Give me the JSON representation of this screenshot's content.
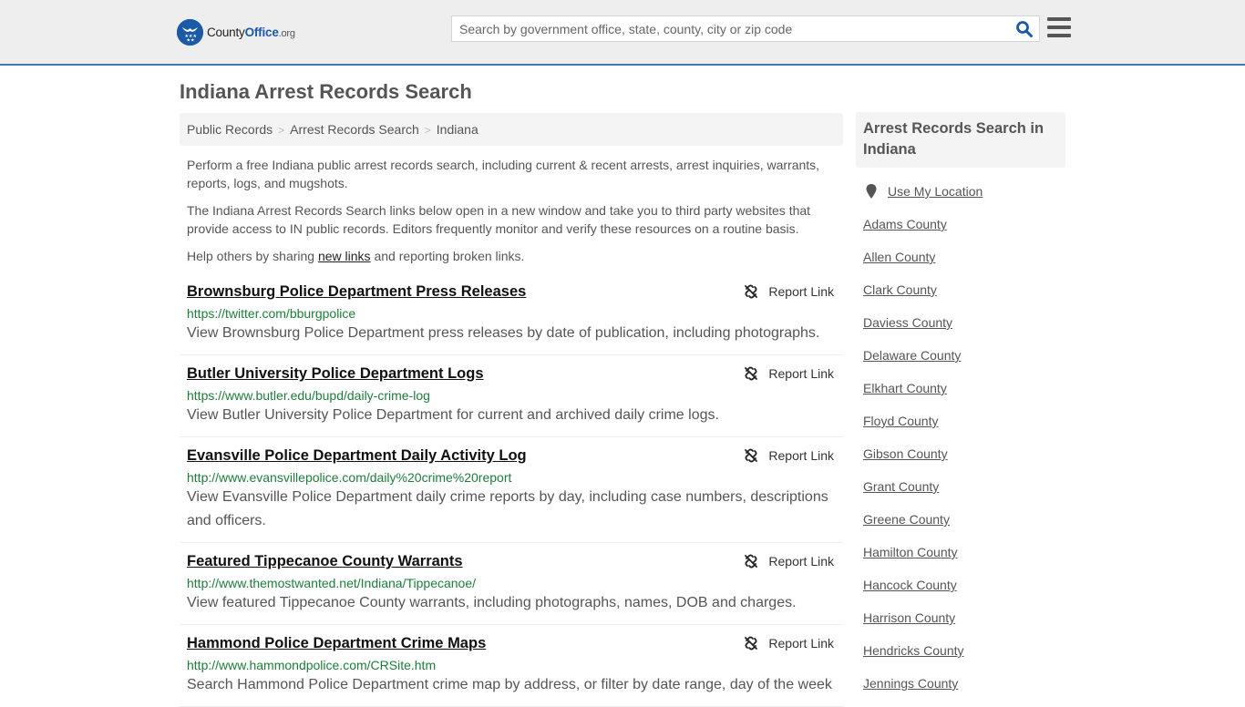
{
  "header": {
    "logo": {
      "name": "County",
      "highlight": "Office",
      "suffix": ".org"
    },
    "search": {
      "placeholder": "Search by government office, state, county, city or zip code",
      "value": ""
    },
    "colors": {
      "brand": "#1a5aa6",
      "header_bg": "#eeeeee",
      "accent_border": "#3b79b7"
    }
  },
  "page": {
    "title": "Indiana Arrest Records Search",
    "breadcrumb": [
      "Public Records",
      "Arrest Records Search",
      "Indiana"
    ],
    "intro": {
      "p1": "Perform a free Indiana public arrest records search, including current & recent arrests, arrest inquiries, warrants, reports, logs, and mugshots.",
      "p2": "The Indiana Arrest Records Search links below open in a new window and take you to third party websites that provide access to IN public records. Editors frequently monitor and verify these resources on a routine basis.",
      "p3_before": "Help others by sharing ",
      "p3_link": "new links",
      "p3_after": " and reporting broken links."
    },
    "report_label": "Report Link",
    "results": [
      {
        "title": "Brownsburg Police Department Press Releases",
        "url": "https://twitter.com/bburgpolice",
        "description": "View Brownsburg Police Department press releases by date of publication, including photographs."
      },
      {
        "title": "Butler University Police Department Logs",
        "url": "https://www.butler.edu/bupd/daily-crime-log",
        "description": "View Butler University Police Department for current and archived daily crime logs."
      },
      {
        "title": "Evansville Police Department Daily Activity Log",
        "url": "http://www.evansvillepolice.com/daily%20crime%20report",
        "description": "View Evansville Police Department daily crime reports by day, including case numbers, descriptions and officers."
      },
      {
        "title": "Featured Tippecanoe County Warrants",
        "url": "http://www.themostwanted.net/Indiana/Tippecanoe/",
        "description": "View featured Tippecanoe County warrants, including photographs, names, DOB and charges."
      },
      {
        "title": "Hammond Police Department Crime Maps",
        "url": "http://www.hammondpolice.com/CRSite.htm",
        "description": "Search Hammond Police Department crime map by address, or filter by date range, day of the week"
      }
    ]
  },
  "sidebar": {
    "heading": "Arrest Records Search in Indiana",
    "location_label": "Use My Location",
    "counties": [
      "Adams County",
      "Allen County",
      "Clark County",
      "Daviess County",
      "Delaware County",
      "Elkhart County",
      "Floyd County",
      "Gibson County",
      "Grant County",
      "Greene County",
      "Hamilton County",
      "Hancock County",
      "Harrison County",
      "Hendricks County",
      "Jennings County"
    ]
  }
}
